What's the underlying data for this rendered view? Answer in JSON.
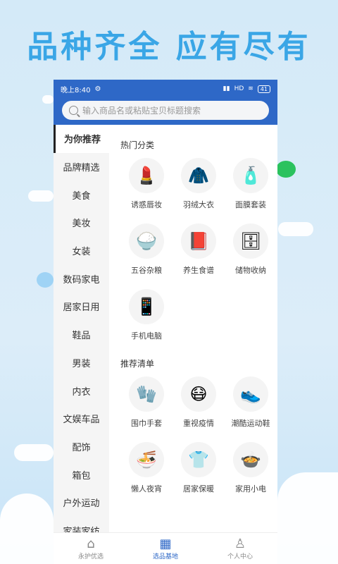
{
  "banner": "品种齐全 应有尽有",
  "status": {
    "time": "晚上8:40",
    "signal": "HD",
    "battery": "41"
  },
  "search": {
    "placeholder": "输入商品名或粘贴宝贝标题搜索"
  },
  "sidebar": {
    "items": [
      "为你推荐",
      "品牌精选",
      "美食",
      "美妆",
      "女装",
      "数码家电",
      "居家日用",
      "鞋品",
      "男装",
      "内衣",
      "文娱车品",
      "配饰",
      "箱包",
      "户外运动",
      "家装家纺"
    ]
  },
  "hot": {
    "title": "热门分类",
    "items": [
      {
        "label": "诱惑唇妆",
        "icon": "lipstick-icon",
        "glyph": "💄"
      },
      {
        "label": "羽绒大衣",
        "icon": "down-jacket-icon",
        "glyph": "🧥"
      },
      {
        "label": "面膜套装",
        "icon": "face-mask-icon",
        "glyph": "🧴"
      },
      {
        "label": "五谷杂粮",
        "icon": "grain-icon",
        "glyph": "🍚"
      },
      {
        "label": "养生食谱",
        "icon": "recipe-book-icon",
        "glyph": "📕"
      },
      {
        "label": "储物收纳",
        "icon": "storage-drawer-icon",
        "glyph": "🗄"
      },
      {
        "label": "手机电脑",
        "icon": "phone-icon",
        "glyph": "📱"
      }
    ]
  },
  "recommend": {
    "title": "推荐清单",
    "items": [
      {
        "label": "围巾手套",
        "icon": "scarf-gloves-icon",
        "glyph": "🧤"
      },
      {
        "label": "重视疫情",
        "icon": "medical-mask-icon",
        "glyph": "😷"
      },
      {
        "label": "潮酷运动鞋",
        "icon": "sneaker-icon",
        "glyph": "👟"
      },
      {
        "label": "懒人夜宵",
        "icon": "snack-icon",
        "glyph": "🍜"
      },
      {
        "label": "居家保暖",
        "icon": "pajamas-icon",
        "glyph": "👕"
      },
      {
        "label": "家用小电",
        "icon": "rice-cooker-icon",
        "glyph": "🍲"
      }
    ]
  },
  "tabs": [
    {
      "label": "永护优选",
      "icon": "home-icon",
      "glyph": "⌂"
    },
    {
      "label": "选品基地",
      "icon": "grid-icon",
      "glyph": "▦"
    },
    {
      "label": "个人中心",
      "icon": "user-icon",
      "glyph": "♙"
    }
  ],
  "colors": {
    "accent": "#2e68c7",
    "banner": "#3aa6e6"
  }
}
